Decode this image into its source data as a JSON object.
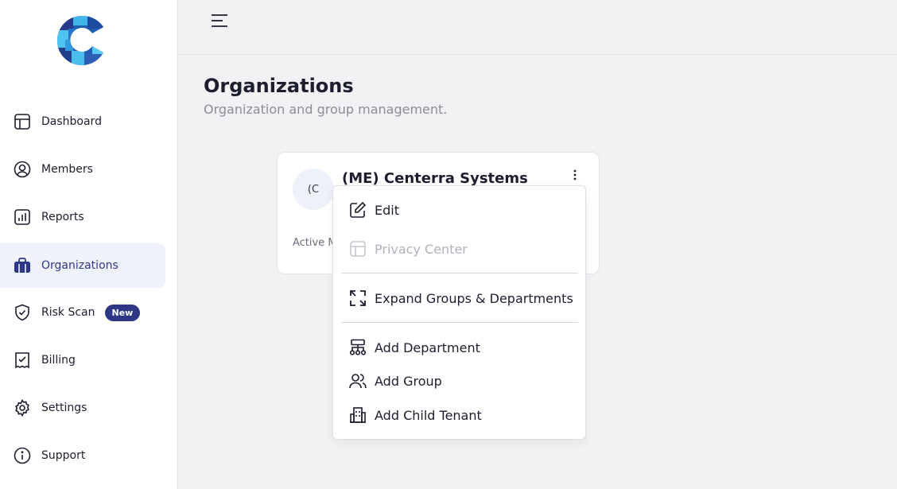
{
  "colors": {
    "accent": "#2e3785",
    "active_bg": "#eef2fb",
    "page_bg": "#f2f2f4"
  },
  "sidebar": {
    "logo_icon": "centerra-logo-icon",
    "items": [
      {
        "label": "Dashboard",
        "icon": "layout-icon"
      },
      {
        "label": "Members",
        "icon": "user-circle-icon"
      },
      {
        "label": "Reports",
        "icon": "bar-chart-icon"
      },
      {
        "label": "Organizations",
        "icon": "briefcase-icon",
        "active": true
      },
      {
        "label": "Risk Scan",
        "icon": "shield-check-icon",
        "badge": "New"
      },
      {
        "label": "Billing",
        "icon": "receipt-icon"
      },
      {
        "label": "Settings",
        "icon": "gear-icon"
      },
      {
        "label": "Support",
        "icon": "info-icon"
      }
    ]
  },
  "header": {
    "menu_icon": "hamburger-icon"
  },
  "main": {
    "title": "Organizations",
    "subtitle": "Organization and group management."
  },
  "card": {
    "avatar_text": "(C",
    "title": "(ME) Centerra Systems",
    "meta": "Active M",
    "menu_icon": "kebab-icon"
  },
  "menu": {
    "items": [
      {
        "label": "Edit",
        "icon": "edit-icon"
      },
      {
        "label": "Privacy Center",
        "icon": "layout-icon",
        "disabled": true
      },
      {
        "label": "Expand Groups & Departments",
        "icon": "expand-icon"
      },
      {
        "label": "Add Department",
        "icon": "hierarchy-icon"
      },
      {
        "label": "Add Group",
        "icon": "users-icon"
      },
      {
        "label": "Add Child Tenant",
        "icon": "building-icon"
      }
    ]
  }
}
